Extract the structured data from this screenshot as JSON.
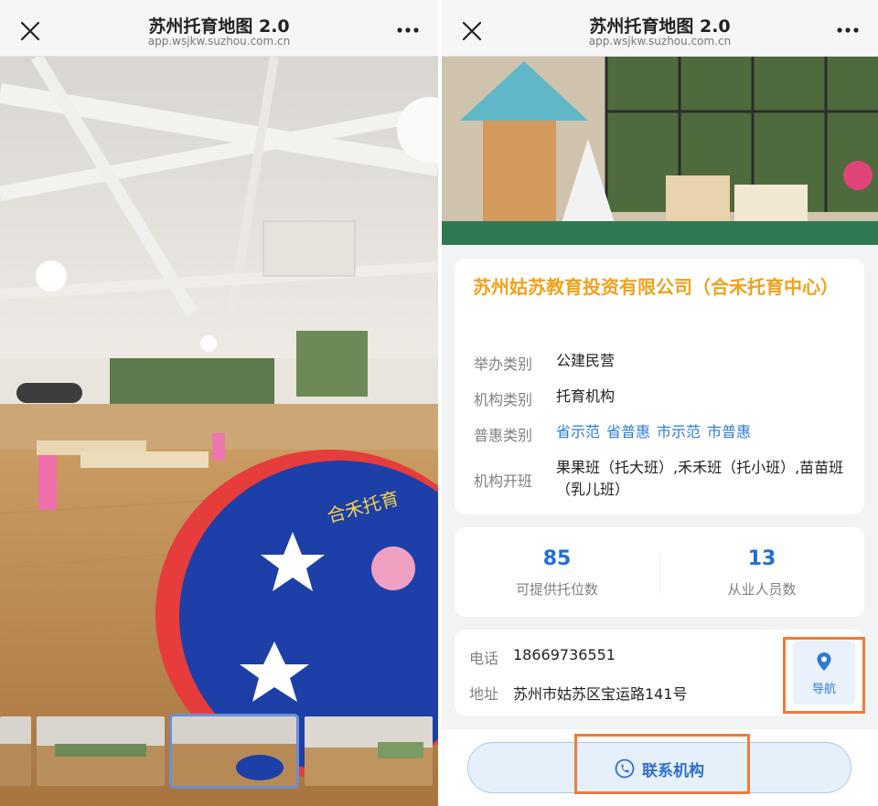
{
  "titlebar": {
    "title": "苏州托育地图 2.0",
    "url": "app.wsjkw.suzhou.com.cn"
  },
  "left_panel": {
    "carpet_text": "合禾托育",
    "thumbnails_count": 4,
    "selected_thumbnail": 3
  },
  "org": {
    "name": "苏州姑苏教育投资有限公司（合禾托育中心）",
    "rows": [
      {
        "label": "举办类别",
        "value": "公建民营"
      },
      {
        "label": "机构类别",
        "value": "托育机构"
      },
      {
        "label": "普惠类别",
        "tags": [
          "省示范",
          "省普惠",
          "市示范",
          "市普惠"
        ]
      },
      {
        "label": "机构开班",
        "value": "果果班（托大班）,禾禾班（托小班）,苗苗班（乳儿班）"
      }
    ]
  },
  "stats": [
    {
      "value": "85",
      "label": "可提供托位数"
    },
    {
      "value": "13",
      "label": "从业人员数"
    }
  ],
  "contact": {
    "phone_label": "电话",
    "phone": "18669736551",
    "address_label": "地址",
    "address": "苏州市姑苏区宝运路141号",
    "nav_label": "导航"
  },
  "contact_button": {
    "label": "联系机构"
  },
  "colors": {
    "accent_orange": "#f0a11d",
    "link_blue": "#2e7bd6",
    "stat_blue": "#1f6fd8",
    "highlight": "#f07a3c"
  },
  "icons": [
    "close-icon",
    "more-icon",
    "location-pin-icon",
    "phone-icon"
  ]
}
